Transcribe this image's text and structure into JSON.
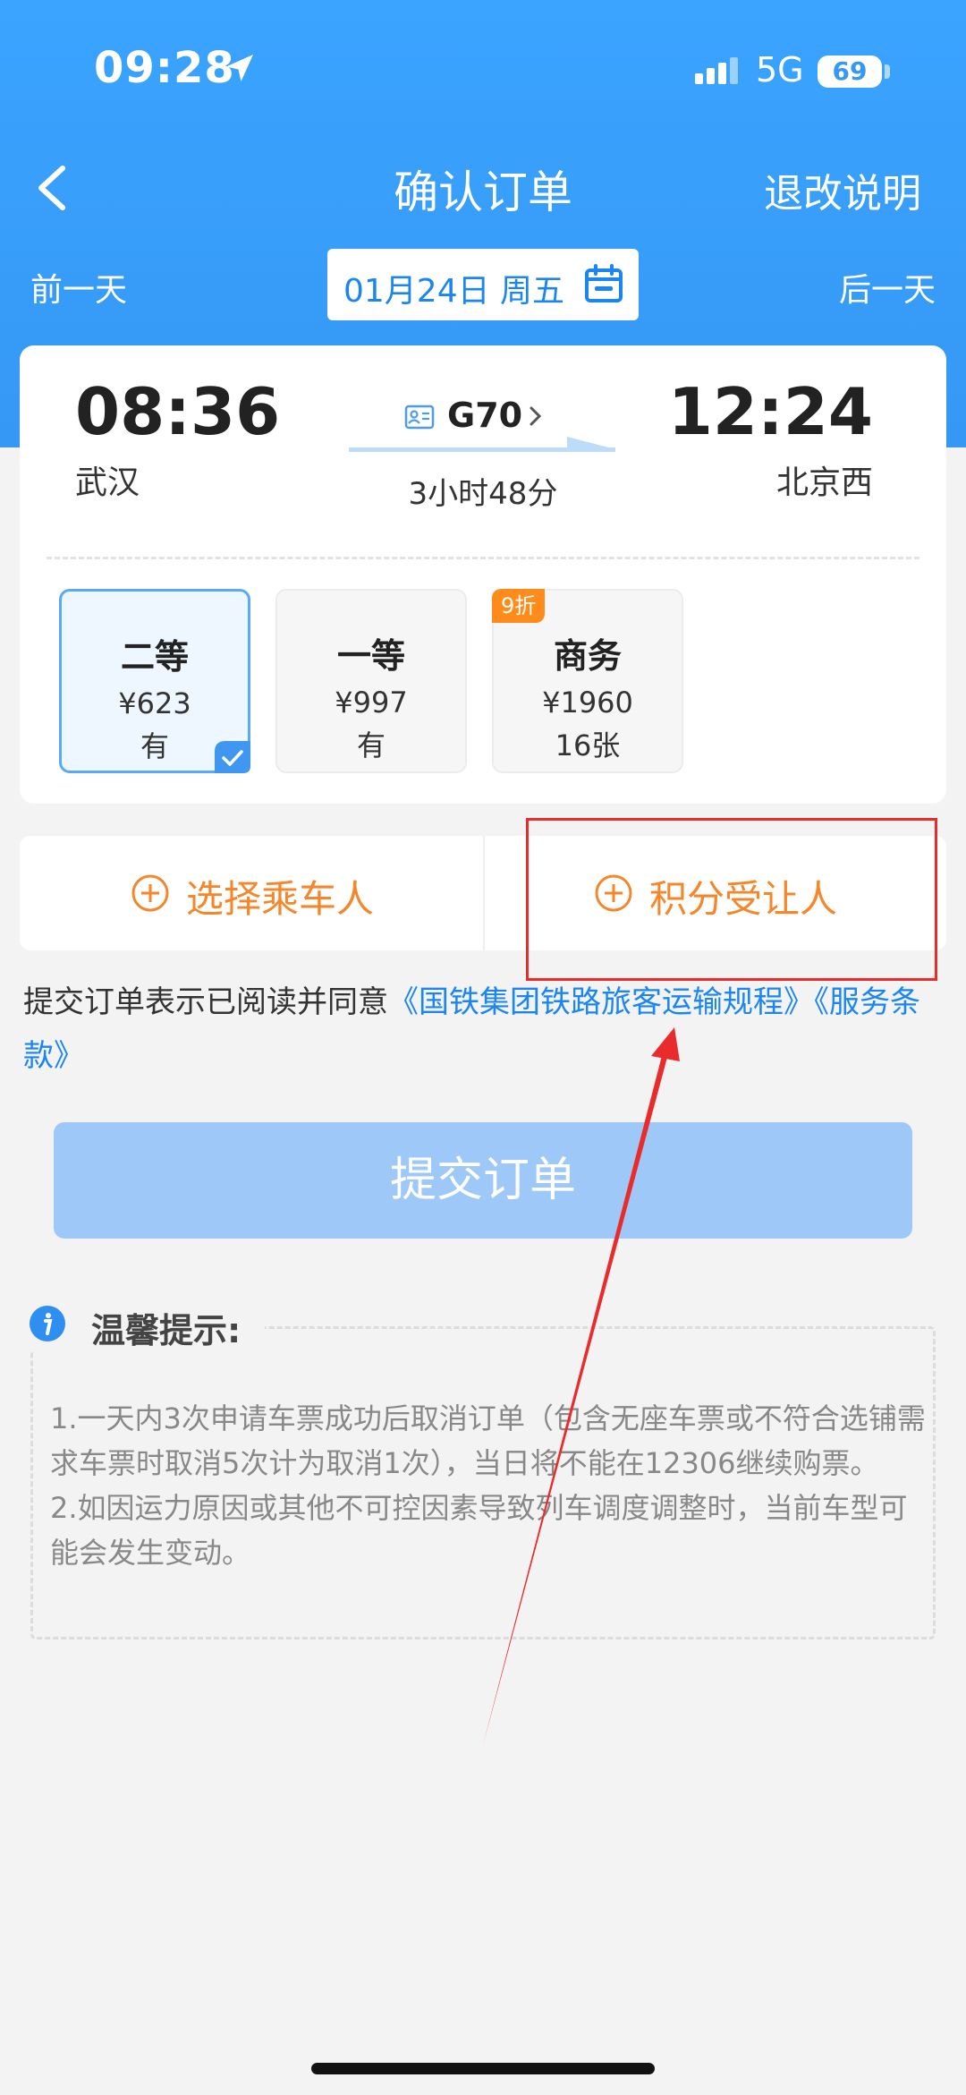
{
  "status_bar": {
    "time": "09:28",
    "network": "5G",
    "battery": "69"
  },
  "nav": {
    "title": "确认订单",
    "rules_link": "退改说明"
  },
  "date_bar": {
    "prev_day": "前一天",
    "date": "01月24日 周五",
    "next_day": "后一天"
  },
  "train": {
    "dep_time": "08:36",
    "dep_station": "武汉",
    "arr_time": "12:24",
    "arr_station": "北京西",
    "train_no": "G70",
    "duration": "3小时48分"
  },
  "seats": [
    {
      "name": "二等",
      "price": "¥623",
      "avail": "有",
      "selected": true
    },
    {
      "name": "一等",
      "price": "¥997",
      "avail": "有",
      "selected": false
    },
    {
      "name": "商务",
      "price": "¥1960",
      "avail": "16张",
      "selected": false,
      "discount": "9折"
    }
  ],
  "passenger": {
    "select_passenger": "选择乘车人",
    "points_transferee": "积分受让人"
  },
  "agreement": {
    "prefix": "提交订单表示已阅读并同意",
    "link1": "《国铁集团铁路旅客运输规程》",
    "link2": "《服务条款》"
  },
  "submit": {
    "label": "提交订单"
  },
  "tips": {
    "title": "温馨提示:",
    "line1": "1.一天内3次申请车票成功后取消订单（包含无座车票或不符合选铺需求车票时取消5次计为取消1次），当日将不能在12306继续购票。",
    "line2": "2.如因运力原因或其他不可控因素导致列车调度调整时，当前车型可能会发生变动。"
  },
  "colors": {
    "primary": "#3598f4",
    "accent_orange": "#f5862a",
    "annotation_red": "#ea2b2b"
  }
}
